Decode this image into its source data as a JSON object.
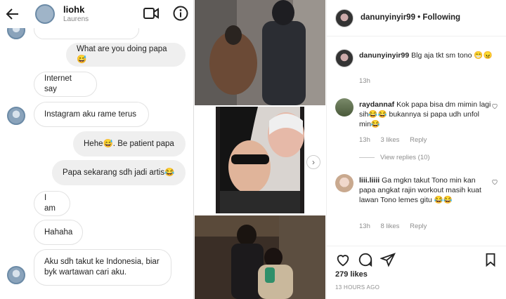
{
  "chat": {
    "contact_name": "liohk",
    "contact_subtitle": "Laurens",
    "messages": [
      {
        "dir": "out",
        "text": "What are you doing papa😅"
      },
      {
        "dir": "in",
        "text": "Internet say"
      },
      {
        "dir": "in",
        "text": "Instagram aku rame terus"
      },
      {
        "dir": "out",
        "text": "Hehe😅.  Be patient papa"
      },
      {
        "dir": "out",
        "text": "Papa sekarang sdh jadi artis😂"
      },
      {
        "dir": "in",
        "text": "I am"
      },
      {
        "dir": "in",
        "text": "Hahaha"
      },
      {
        "dir": "in",
        "text": "Aku sdh takut ke Indonesia, biar byk wartawan cari aku."
      }
    ]
  },
  "post": {
    "username": "danunyinyir99",
    "separator": "•",
    "follow_status": "Following",
    "caption": {
      "user": "danunyinyir99",
      "text": "Blg aja tkt sm tono 😁😠",
      "time": "13h"
    },
    "comments": [
      {
        "user": "raydannaf",
        "text": "Kok papa bisa dm mimin lagi sih😂😂 bukannya si papa udh unfol min😂",
        "time": "13h",
        "likes": "3 likes",
        "reply": "Reply",
        "view_replies": "View replies (10)"
      },
      {
        "user": "liii.liiii",
        "text": "Ga mgkn takut Tono min kan papa angkat rajin workout masih kuat lawan Tono lemes gitu 😂😂",
        "time": "13h",
        "likes": "8 likes",
        "reply": "Reply"
      }
    ],
    "likes_count": "279 likes",
    "posted_ago": "13 HOURS AGO"
  },
  "icons": {
    "back": "back-arrow-icon",
    "video": "video-call-icon",
    "info": "info-icon",
    "heart": "heart-icon",
    "comment": "comment-icon",
    "share": "share-icon",
    "bookmark": "bookmark-icon"
  }
}
